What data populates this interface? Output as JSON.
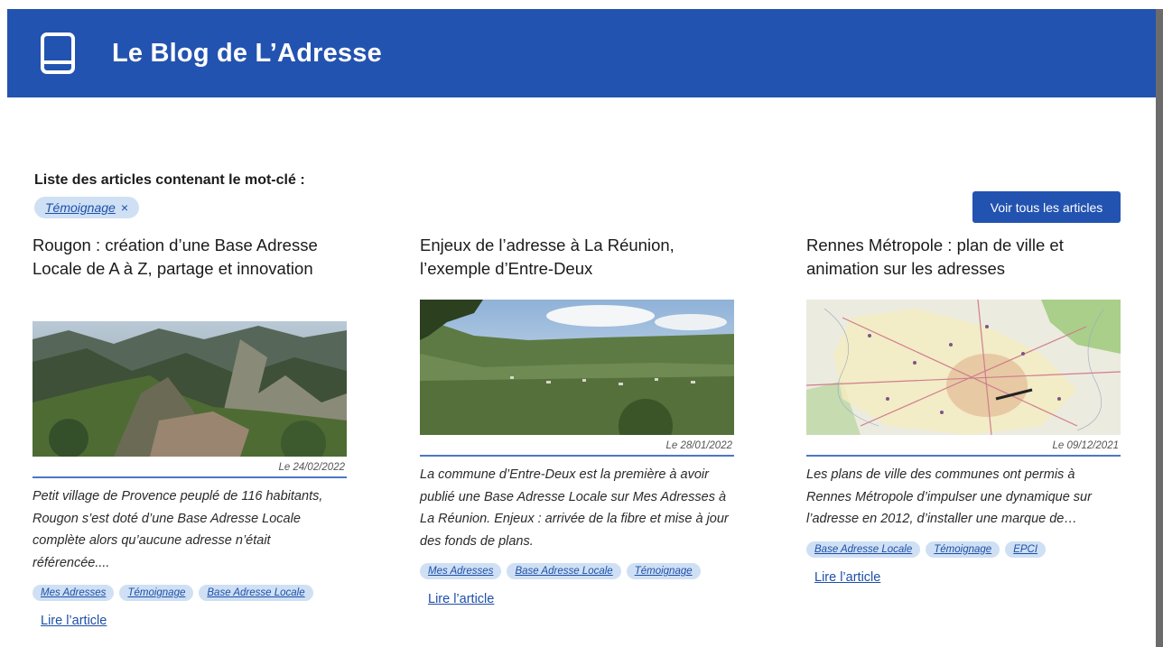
{
  "header": {
    "site_title": "Le Blog de L’Adresse"
  },
  "filter": {
    "intro": "Liste des articles contenant le mot-clé :",
    "keyword": "Témoignage",
    "remove_symbol": "×",
    "all_articles_button": "Voir tous les articles"
  },
  "articles": [
    {
      "title": "Rougon : création d’une Base Adresse Locale de A à Z, partage et innovation",
      "date": "Le 24/02/2022",
      "excerpt": "Petit village de Provence peuplé de 116 habitants, Rougon s’est doté d’une Base Adresse Locale complète alors qu’aucune adresse n’était référencée....",
      "tags": [
        "Mes Adresses",
        "Témoignage",
        "Base Adresse Locale"
      ],
      "read_more": "Lire l’article",
      "image_icon": "mountain-village-photo"
    },
    {
      "title": "Enjeux de l’adresse à La Réunion, l’exemple d’Entre-Deux",
      "date": "Le 28/01/2022",
      "excerpt": "La commune d’Entre-Deux est la première à avoir publié une Base Adresse Locale sur Mes Adresses à La Réunion. Enjeux : arrivée de la fibre et mise à jour des fonds de plans.",
      "tags": [
        "Mes Adresses",
        "Base Adresse Locale",
        "Témoignage"
      ],
      "read_more": "Lire l’article",
      "image_icon": "valley-landscape-photo"
    },
    {
      "title": "Rennes Métropole : plan de ville et animation sur les adresses",
      "date": "Le 09/12/2021",
      "excerpt": "Les plans de ville des communes ont permis à Rennes Métropole d’impulser une dynamique sur l’adresse en 2012, d’installer une marque de…",
      "tags": [
        "Base Adresse Locale",
        "Témoignage",
        "EPCI"
      ],
      "read_more": "Lire l’article",
      "image_icon": "city-map-image"
    }
  ],
  "colors": {
    "brand": "#2353b0",
    "chip_bg": "#cfe0f4",
    "link": "#1d4fa8"
  }
}
